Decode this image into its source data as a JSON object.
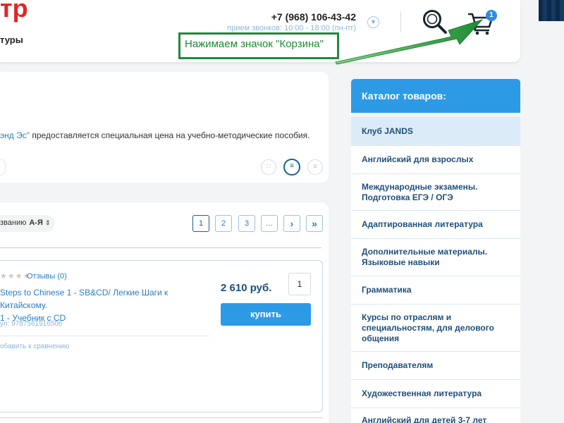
{
  "header": {
    "logo_fragment": "тр",
    "logo_subtitle": "туры",
    "phone": "+7 (968) 106-43-42",
    "hours": "прием звонков: 10:00 - 18:00 (пн-пт)",
    "cart_count": "1",
    "icons": {
      "phone_dropdown": "chevron-down-icon",
      "search": "search-icon",
      "cart": "cart-icon"
    }
  },
  "annotation": {
    "callout_text": "Нажимаем значок \"Корзина\"",
    "color": "#1e8a35"
  },
  "info": {
    "link_fragment": "энд Эс\"",
    "text": " предоставляется специальная цена на учебно-методические пособия.",
    "view_icons": [
      "grid-view-icon",
      "list-view-icon",
      "table-view-icon"
    ]
  },
  "listing": {
    "sort_label": "званию",
    "sort_value": "А-Я",
    "pagination": [
      "1",
      "2",
      "3",
      "...",
      "›",
      "»"
    ],
    "active_page": "1"
  },
  "product": {
    "reviews": "Отзывы (0)",
    "title_line1": "Steps to Chinese 1 - SB&CD/ Легкие Шаги к Китайскому.",
    "title_line2": "1 - Учебник с CD",
    "sku": "ул: 9787561916506",
    "compare": "обавить к сравнению",
    "price": "2 610 руб.",
    "quantity": "1",
    "buy_label": "купить"
  },
  "catalog": {
    "title": "Каталог товаров:",
    "items": [
      "Клуб JANDS",
      "Английский для взрослых",
      "Международные экзамены. Подготовка ЕГЭ / ОГЭ",
      "Адаптированная литература",
      "Дополнительные материалы. Языковые навыки",
      "Грамматика",
      "Курсы по отраслям и специальностям, для делового общения",
      "Преподавателям",
      "Художественная литература",
      "Английский для детей 3-7 лет"
    ]
  },
  "colors": {
    "accent_blue": "#2d9ae6",
    "dark_blue": "#1f4f7a",
    "logo_red": "#e32526",
    "callout_green": "#1e8a35"
  }
}
